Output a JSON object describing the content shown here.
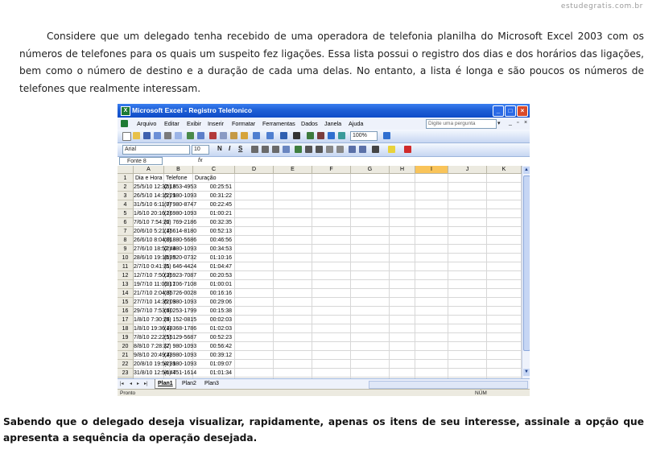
{
  "watermark": "estudegratis.com.br",
  "intro_text": "Considere que um delegado tenha recebido de uma operadora de telefonia planilha do Microsoft Excel 2003 com os números de telefones para os quais um suspeito fez ligações. Essa lista possui o registro dos dias e dos horários das ligações, bem como o número de destino e a duração de cada uma delas. No entanto, a lista é longa e são poucos os números de telefones que realmente interessam.",
  "question_text": "Sabendo que o delegado deseja visualizar, rapidamente, apenas os itens de seu interesse, assinale a opção que apresenta a sequência da operação desejada.",
  "excel": {
    "title": "Microsoft Excel - Registro Telefonico",
    "menu": [
      "Arquivo",
      "Editar",
      "Exibir",
      "Inserir",
      "Formatar",
      "Ferramentas",
      "Dados",
      "Janela",
      "Ajuda"
    ],
    "help_placeholder": "Digite uma pergunta",
    "zoom": "100%",
    "font_name": "Arial",
    "font_size": "10",
    "name_box": "Fonte 8",
    "fx_label": "fx",
    "columns": [
      "A",
      "B",
      "C",
      "D",
      "E",
      "F",
      "G",
      "H",
      "I",
      "J",
      "K"
    ],
    "selected_column": "I",
    "headers": [
      "Dia e Hora",
      "Telefone",
      "Duração"
    ],
    "rows": [
      [
        "25/5/10 12:32:16",
        "(5) 353-4953",
        "00:25:51"
      ],
      [
        "26/5/10 14:15:21",
        "(2) 980-1093",
        "00:31:22"
      ],
      [
        "31/5/10 6:11:07",
        "(7) 980-8747",
        "00:22:45"
      ],
      [
        "1/6/10 20:16:16",
        "(2) 980-1093",
        "01:00:21"
      ],
      [
        "7/6/10 7:54:22",
        "(6) 769-2186",
        "00:32:35"
      ],
      [
        "20/6/10 5:21:45",
        "(1) 614-8180",
        "00:52:13"
      ],
      [
        "26/6/10 8:04:01",
        "(8) 880-5686",
        "00:46:56"
      ],
      [
        "27/6/10 18:52:44",
        "(2) 980-1093",
        "00:34:53"
      ],
      [
        "28/6/10 19:18:35",
        "(5) 920-0732",
        "01:10:16"
      ],
      [
        "2/7/10 0:41:31",
        "(5) 646-4424",
        "01:04:47"
      ],
      [
        "12/7/10 7:50:25",
        "(3) 923-7087",
        "00:20:53"
      ],
      [
        "19/7/10 11:05:17",
        "(3) 106-7108",
        "01:00:01"
      ],
      [
        "21/7/10 2:04:35",
        "(8) 726-0028",
        "00:16:16"
      ],
      [
        "27/7/10 14:35:03",
        "(2) 980-1093",
        "00:29:06"
      ],
      [
        "29/7/10 7:53:40",
        "(5) 253-1799",
        "00:15:38"
      ],
      [
        "1/8/10 7:30:24",
        "(5) 152-0815",
        "00:02:03"
      ],
      [
        "1/8/10 19:36:48",
        "(1) 368-1786",
        "01:02:03"
      ],
      [
        "7/8/10 22:22:15",
        "(5) 129-5687",
        "00:52:23"
      ],
      [
        "8/8/10 7:28:37",
        "(2) 980-1093",
        "00:56:42"
      ],
      [
        "9/8/10 20:49:43",
        "(2) 980-1093",
        "00:39:12"
      ],
      [
        "20/8/10 19:54:31",
        "(2) 980-1093",
        "01:09:07"
      ],
      [
        "31/8/10 12:54:47",
        "(5) 451-1614",
        "01:01:34"
      ]
    ],
    "sheet_tabs": [
      "Plan1",
      "Plan2",
      "Plan3"
    ],
    "active_sheet": "Plan1",
    "status_left": "Pronto",
    "status_right": "NÚM"
  }
}
